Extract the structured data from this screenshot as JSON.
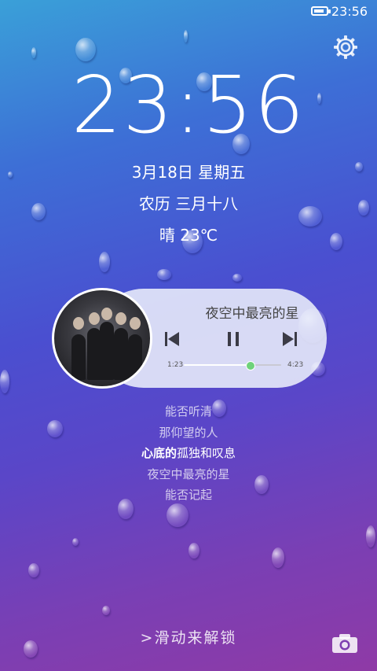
{
  "status_bar": {
    "time": "23:56",
    "battery_level": 0.7
  },
  "lockscreen": {
    "clock": "23:56",
    "date": "3月18日 星期五",
    "lunar": "农历 三月十八",
    "weather": "晴 23℃",
    "unlock_hint_arrow": ">",
    "unlock_hint": "滑动来解锁"
  },
  "player": {
    "song_title": "夜空中最亮的星",
    "current_time": "1:23",
    "total_time": "4:23",
    "progress": 0.68,
    "controls": [
      "previous-icon",
      "pause-icon",
      "next-icon"
    ]
  },
  "lyrics": {
    "lines": [
      "能否听清",
      "那仰望的人",
      "心底的孤独和叹息",
      "夜空中最亮的星",
      "能否记起"
    ],
    "active_index": 2,
    "active_highlight": "心底的",
    "active_rest": "孤独和叹息"
  },
  "icons": {
    "settings": "gear-icon",
    "camera": "camera-icon"
  },
  "colors": {
    "progress_knob": "#6fd27a",
    "card_bg": "#ebeefa"
  }
}
